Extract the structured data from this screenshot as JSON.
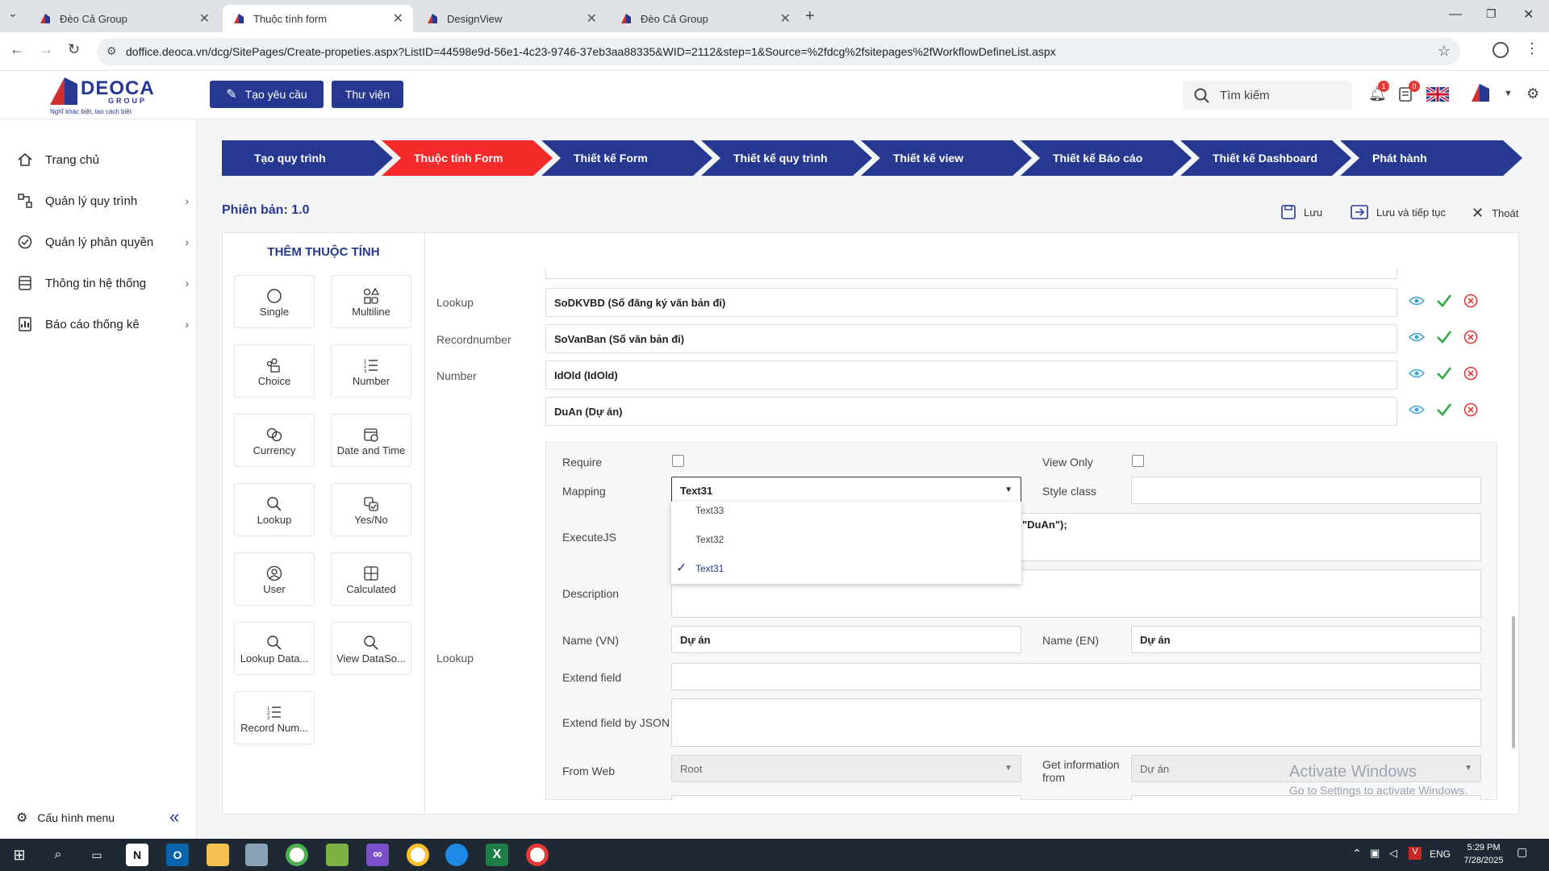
{
  "browser": {
    "tabs": [
      {
        "label": "Đèo Cả Group",
        "active": false
      },
      {
        "label": "Thuộc tính form",
        "active": true
      },
      {
        "label": "DesignView",
        "active": false
      },
      {
        "label": "Đèo Cả Group",
        "active": false
      }
    ],
    "url": "doffice.deoca.vn/dcg/SitePages/Create-propeties.aspx?ListID=44598e9d-56e1-4c23-9746-37eb3aa88335&WID=2112&step=1&Source=%2fdcg%2fsitepages%2fWorkflowDefineList.aspx"
  },
  "header": {
    "logo_main": "DEOCA",
    "logo_sub": "GROUP",
    "logo_tagline": "Nghĩ khác biệt, tạo cách biệt",
    "create_button": "Tạo yêu cầu",
    "library_button": "Thư viện",
    "search_placeholder": "Tìm kiếm",
    "notif_count": "1",
    "tasks_count": "0"
  },
  "sidebar": {
    "items": [
      {
        "label": "Trang chủ",
        "icon": "home-icon"
      },
      {
        "label": "Quản lý quy trình",
        "icon": "workflow-icon"
      },
      {
        "label": "Quản lý phân quyền",
        "icon": "permission-icon"
      },
      {
        "label": "Thông tin hệ thống",
        "icon": "server-icon"
      },
      {
        "label": "Báo cáo thống kê",
        "icon": "report-icon"
      }
    ],
    "config_menu": "Cấu hình menu"
  },
  "steps": [
    "Tạo quy trình",
    "Thuộc tính Form",
    "Thiết kế Form",
    "Thiết kế quy trình",
    "Thiết kế view",
    "Thiết kế Báo cáo",
    "Thiết kế Dashboard",
    "Phát hành"
  ],
  "active_step": 1,
  "version": "Phiên bản: 1.0",
  "actions": {
    "save": "Lưu",
    "save_continue": "Lưu và tiếp tục",
    "exit": "Thoát"
  },
  "palette": {
    "title": "THÊM THUỘC TÍNH",
    "items": [
      "Single",
      "Multiline",
      "Choice",
      "Number",
      "Currency",
      "Date and Time",
      "Lookup",
      "Yes/No",
      "User",
      "Calculated",
      "Lookup Data...",
      "View DataSo...",
      "Record Num..."
    ]
  },
  "fields": [
    {
      "type": "Lookup",
      "value": "SoDKVBD (Số đăng ký văn bản đi)"
    },
    {
      "type": "Recordnumber",
      "value": "SoVanBan (Số văn bản đi)"
    },
    {
      "type": "Number",
      "value": "IdOld (IdOld)"
    },
    {
      "type": "",
      "value": "DuAn (Dự án)"
    }
  ],
  "editor": {
    "type_label": "Lookup",
    "require_label": "Require",
    "view_only_label": "View Only",
    "mapping_label": "Mapping",
    "mapping_value": "Text31",
    "style_class_label": "Style class",
    "executejs_label": "ExecuteJS",
    "executejs_visible": "\"DuAn\");",
    "description_label": "Description",
    "name_vn_label": "Name (VN)",
    "name_vn_value": "Dự án",
    "name_en_label": "Name (EN)",
    "name_en_value": "Dự án",
    "extend_field_label": "Extend field",
    "extend_json_label": "Extend field by JSON",
    "from_web_label": "From Web",
    "from_web_value": "Root",
    "get_info_label": "Get information from",
    "get_info_value": "Dự án"
  },
  "mapping_options": [
    {
      "label": "Text33",
      "selected": false
    },
    {
      "label": "Text32",
      "selected": false
    },
    {
      "label": "Text31",
      "selected": true
    }
  ],
  "watermark": {
    "line1": "Activate Windows",
    "line2": "Go to Settings to activate Windows."
  },
  "taskbar": {
    "lang": "ENG",
    "time": "5:29 PM",
    "date": "7/28/2025"
  },
  "colors": {
    "brand_blue": "#26388f",
    "active_step": "#f52a2a",
    "ok_green": "#2eaa3f",
    "cancel_red": "#e53935"
  }
}
